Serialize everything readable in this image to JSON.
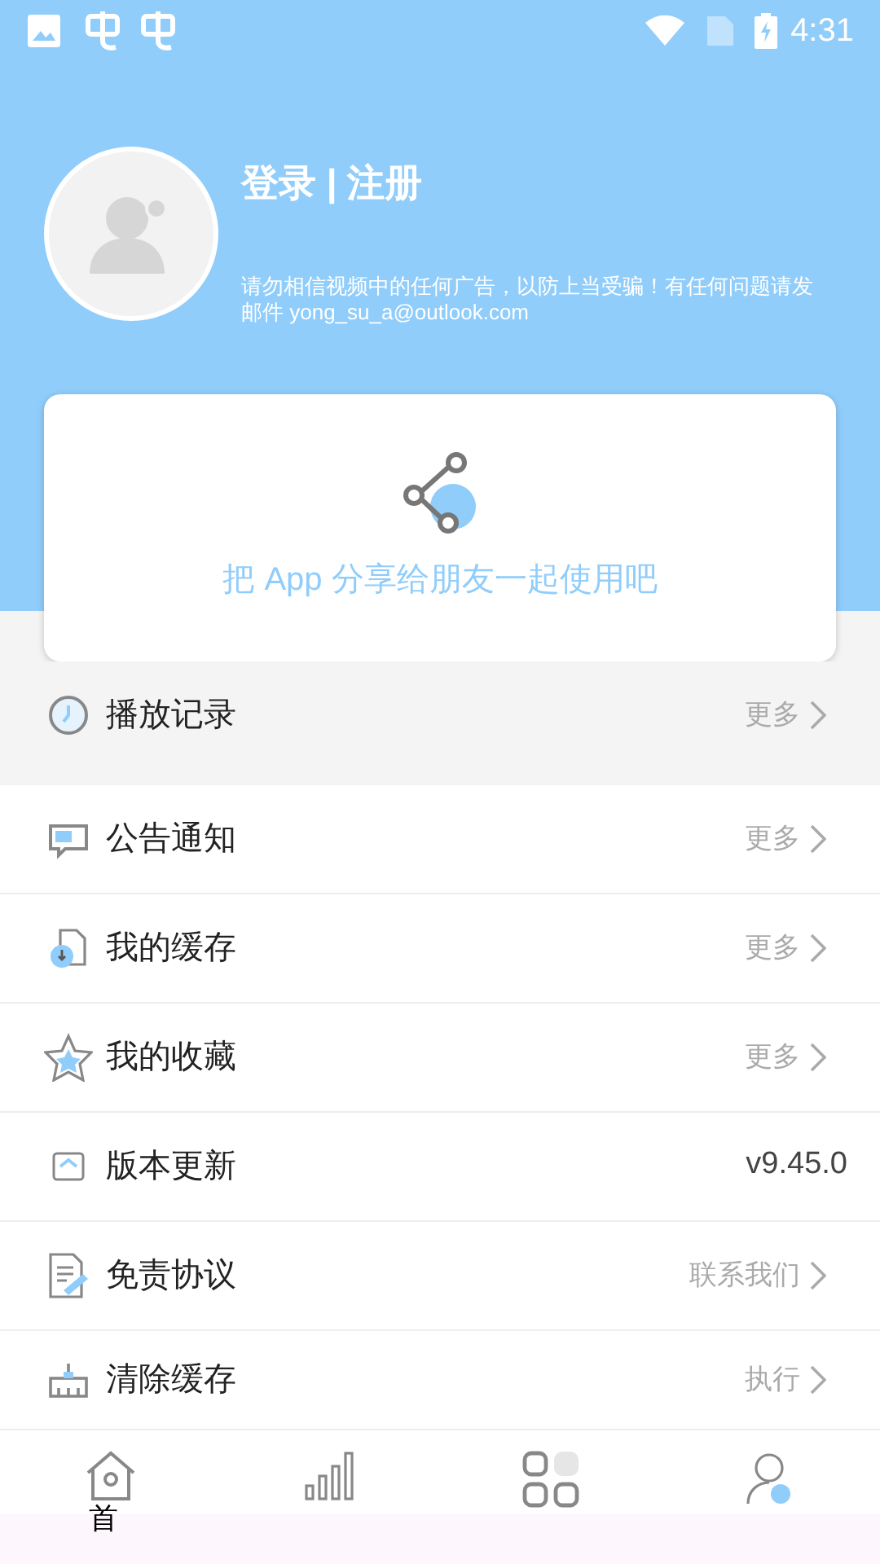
{
  "status_bar": {
    "time": "4:31"
  },
  "profile": {
    "title": "登录 | 注册",
    "notice": "请勿相信视频中的任何广告，以防上当受骗！有任何问题请发邮件 yong_su_a@outlook.com"
  },
  "share_card": {
    "label": "把 App 分享给朋友一起使用吧"
  },
  "menu": [
    {
      "kind": "history",
      "label": "播放记录",
      "action": "更多",
      "chevron": true,
      "highlighted": true
    },
    {
      "kind": "notice",
      "label": "公告通知",
      "action": "更多",
      "chevron": true,
      "highlighted": false
    },
    {
      "kind": "download",
      "label": "我的缓存",
      "action": "更多",
      "chevron": true,
      "highlighted": false
    },
    {
      "kind": "favorite",
      "label": "我的收藏",
      "action": "更多",
      "chevron": true,
      "highlighted": false
    },
    {
      "kind": "update",
      "label": "版本更新",
      "action": "v9.45.0",
      "chevron": false,
      "highlighted": false
    },
    {
      "kind": "agreement",
      "label": "免责协议",
      "action": "联系我们",
      "chevron": true,
      "highlighted": false
    },
    {
      "kind": "clear",
      "label": "清除缓存",
      "action": "执行",
      "chevron": true,
      "highlighted": false
    }
  ],
  "bottom_nav": [
    {
      "kind": "home",
      "label": "首",
      "selected": false
    },
    {
      "kind": "ranking",
      "selected": false
    },
    {
      "kind": "categories",
      "selected": false
    },
    {
      "kind": "profile",
      "selected": true
    }
  ]
}
